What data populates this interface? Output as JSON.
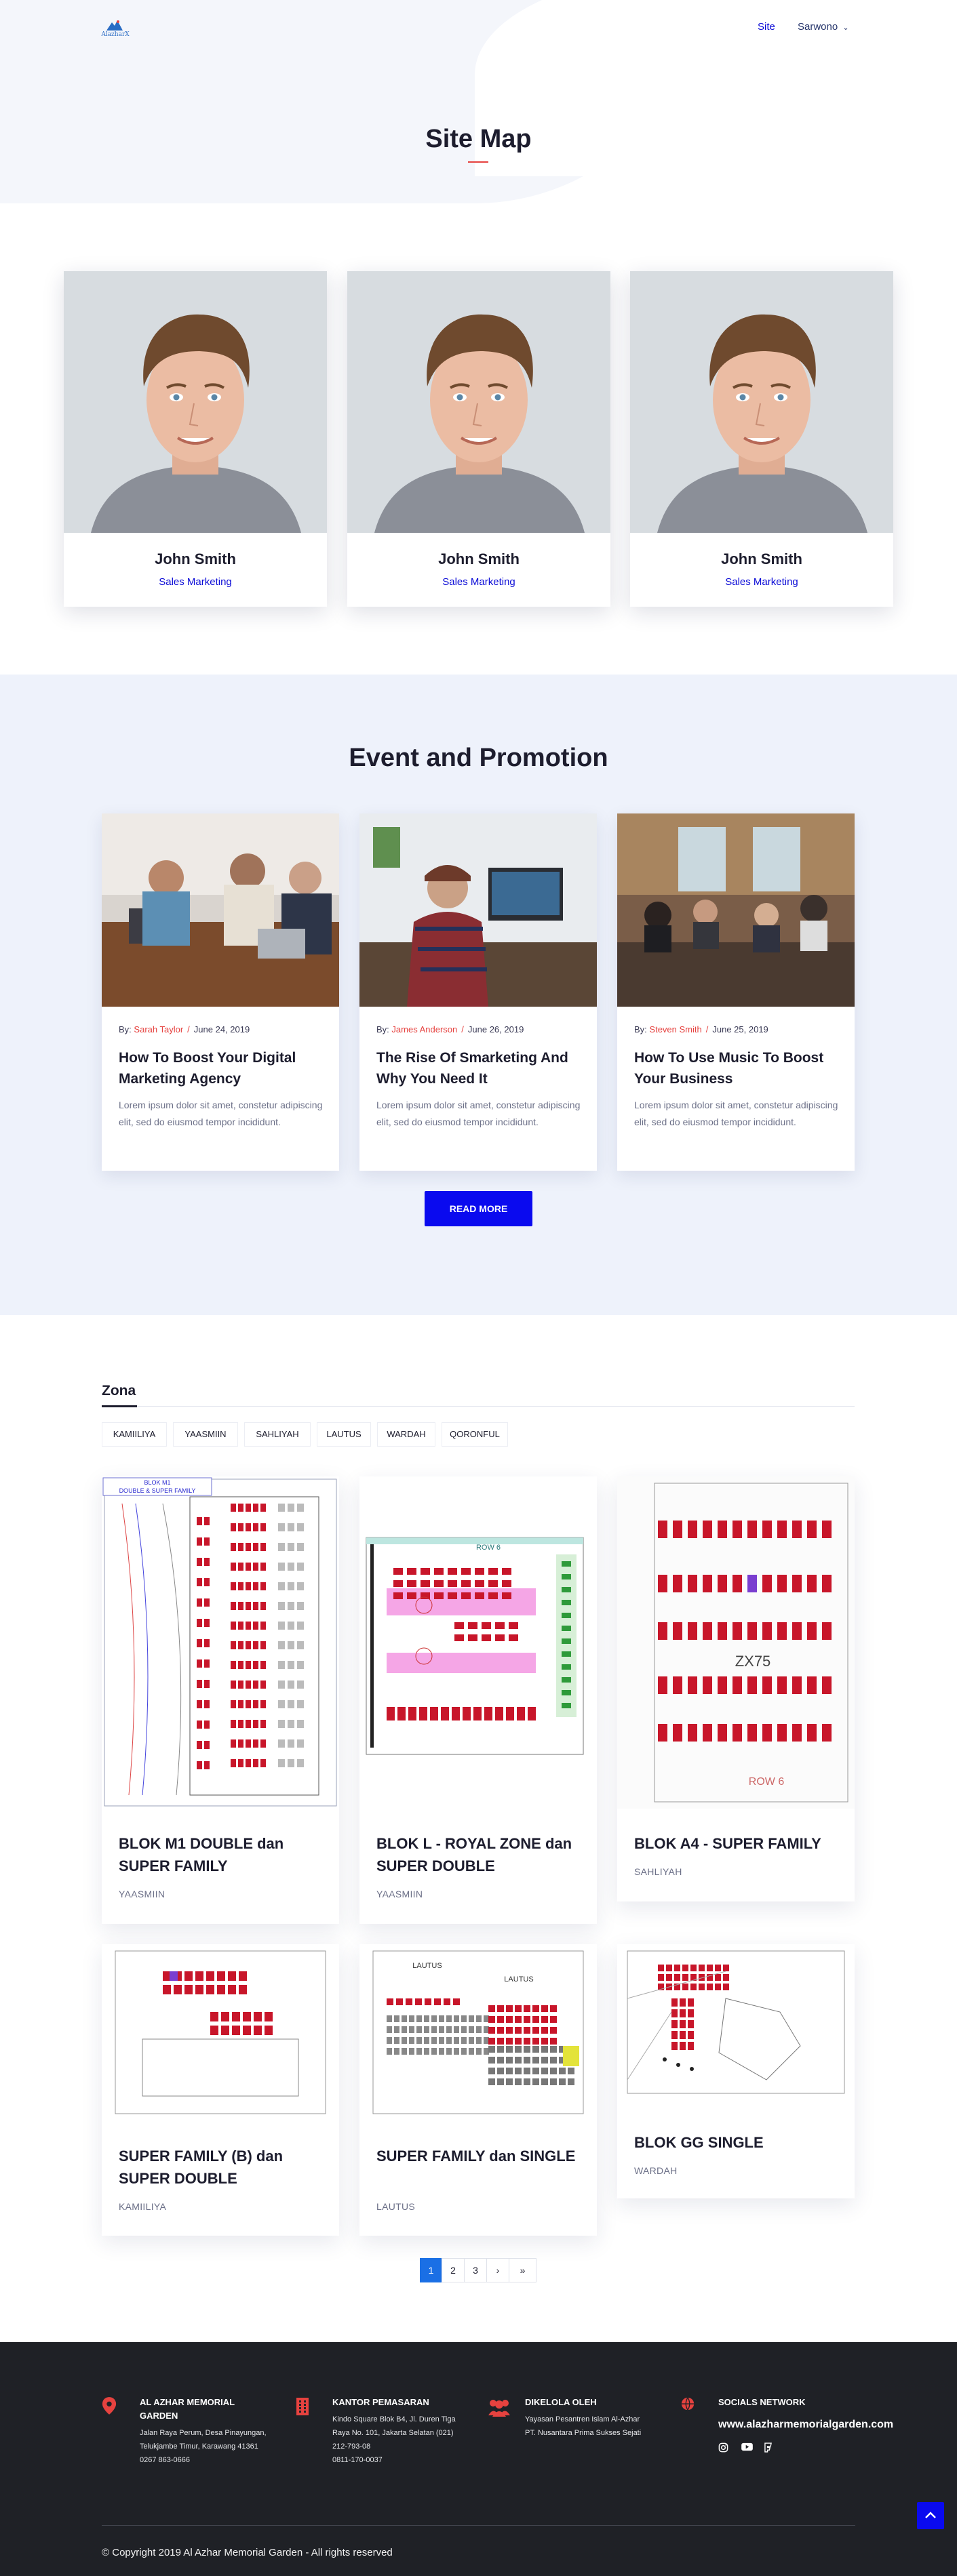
{
  "header": {
    "logo_text": "AlazharX",
    "nav": [
      {
        "label": "Site",
        "active": true
      },
      {
        "label": "Sarwono",
        "dropdown": true
      }
    ],
    "page_title": "Site Map"
  },
  "team": [
    {
      "name": "John Smith",
      "role": "Sales Marketing"
    },
    {
      "name": "John Smith",
      "role": "Sales Marketing"
    },
    {
      "name": "John Smith",
      "role": "Sales Marketing"
    }
  ],
  "events": {
    "title": "Event and Promotion",
    "posts": [
      {
        "by": "By:",
        "author": "Sarah Taylor",
        "date": "June 24, 2019",
        "title": "How To Boost Your Digital Marketing Agency",
        "excerpt": "Lorem ipsum dolor sit amet, constetur adipiscing elit, sed do eiusmod tempor incididunt."
      },
      {
        "by": "By:",
        "author": "James Anderson",
        "date": "June 26, 2019",
        "title": "The Rise Of Smarketing And Why You Need It",
        "excerpt": "Lorem ipsum dolor sit amet, constetur adipiscing elit, sed do eiusmod tempor incididunt."
      },
      {
        "by": "By:",
        "author": "Steven Smith",
        "date": "June 25, 2019",
        "title": "How To Use Music To Boost Your Business",
        "excerpt": "Lorem ipsum dolor sit amet, constetur adipiscing elit, sed do eiusmod tempor incididunt."
      }
    ],
    "read_more": "READ MORE"
  },
  "zona": {
    "label": "Zona",
    "tabs": [
      "KAMIILIYA",
      "YAASMIIN",
      "SAHLIYAH",
      "LAUTUS",
      "WARDAH",
      "QORONFUL"
    ],
    "items": [
      {
        "title": "BLOK M1 DOUBLE dan SUPER FAMILY",
        "category": "YAASMIIN",
        "plan_caption": "BLOK M1 DOUBLE & SUPER FAMILY"
      },
      {
        "title": "BLOK L - ROYAL ZONE dan SUPER DOUBLE",
        "category": "YAASMIIN",
        "plan_caption": "ROW 6"
      },
      {
        "title": "BLOK A4 - SUPER FAMILY",
        "category": "SAHLIYAH",
        "plan_caption": "ZX75"
      },
      {
        "title": "SUPER FAMILY (B) dan SUPER DOUBLE",
        "category": "KAMIILIYA",
        "plan_caption": ""
      },
      {
        "title": "SUPER FAMILY dan SINGLE",
        "category": "LAUTUS",
        "plan_caption": "LAUTUS"
      },
      {
        "title": "BLOK GG SINGLE",
        "category": "WARDAH",
        "plan_caption": ""
      }
    ]
  },
  "pagination": [
    "1",
    "2",
    "3",
    "›",
    "»"
  ],
  "footer": {
    "columns": [
      {
        "icon": "map-pin-icon",
        "title": "AL AZHAR MEMORIAL GARDEN",
        "lines": [
          "Jalan Raya Perum, Desa Pinayungan,",
          "Telukjambe Timur, Karawang 41361",
          "0267 863-0666"
        ]
      },
      {
        "icon": "building-icon",
        "title": "KANTOR PEMASARAN",
        "lines": [
          "Kindo Square Blok B4, Jl. Duren Tiga",
          "Raya No. 101, Jakarta Selatan (021)",
          "212-793-08",
          "0811-170-0037"
        ]
      },
      {
        "icon": "users-icon",
        "title": "DIKELOLA OLEH",
        "lines": [
          "Yayasan Pesantren Islam Al-Azhar",
          "PT. Nusantara Prima Sukses Sejati"
        ]
      },
      {
        "icon": "globe-icon",
        "title": "SOCIALS NETWORK",
        "lines": [
          "www.alazharmemorialgarden.com"
        ]
      }
    ],
    "social_icons": [
      "instagram-icon",
      "youtube-icon",
      "foursquare-icon"
    ],
    "copyright": "Copyright 2019 Al Azhar Memorial Garden - All rights reserved"
  },
  "colors": {
    "accent": "#0a0aef",
    "red": "#e6423f",
    "footer": "#1f2126",
    "event_bg": "#eef2fb"
  }
}
